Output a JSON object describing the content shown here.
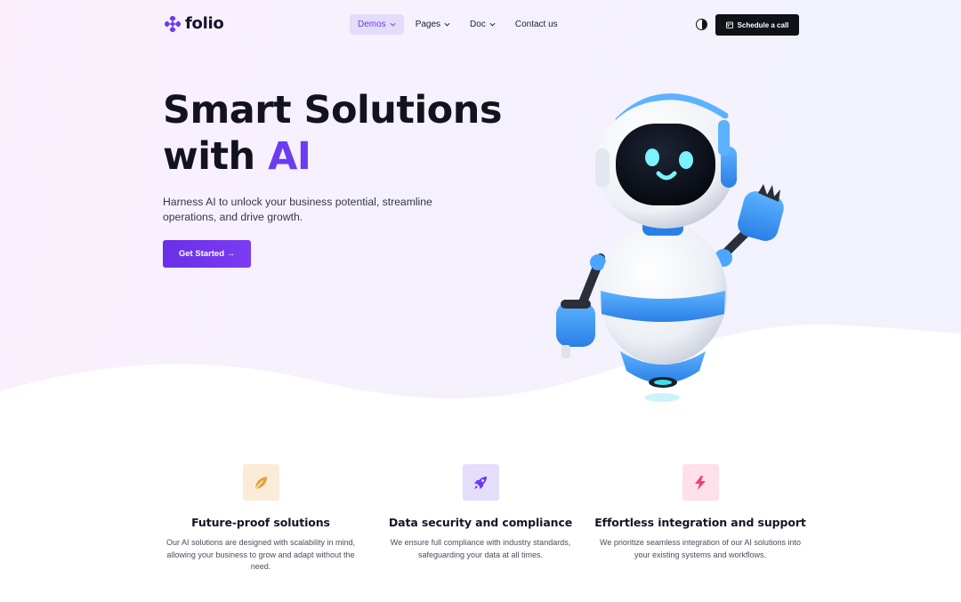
{
  "brand": {
    "name": "folio",
    "accent": "#6b3cf0"
  },
  "nav": {
    "items": [
      {
        "label": "Demos",
        "has_dropdown": true,
        "active": true
      },
      {
        "label": "Pages",
        "has_dropdown": true,
        "active": false
      },
      {
        "label": "Doc",
        "has_dropdown": true,
        "active": false
      },
      {
        "label": "Contact us",
        "has_dropdown": false,
        "active": false
      }
    ],
    "theme_toggle_icon": "half-circle-icon",
    "schedule_label": "Schedule a call",
    "schedule_icon": "calendar-icon"
  },
  "hero": {
    "title_line1": "Smart Solutions",
    "title_line2_prefix": "with ",
    "title_line2_accent": "AI",
    "subtitle": "Harness AI to unlock your business potential, streamline operations, and drive growth.",
    "cta_label": "Get Started →",
    "illustration": "robot-waving"
  },
  "features": [
    {
      "icon": "leaf-icon",
      "icon_bg": "#fbecd7",
      "icon_color": "#e5a23c",
      "title": "Future-proof solutions",
      "description": "Our AI solutions are designed with scalability in mind, allowing your business to grow and adapt without the need."
    },
    {
      "icon": "rocket-icon",
      "icon_bg": "#e4ddfb",
      "icon_color": "#6b3cf0",
      "title": "Data security and compliance",
      "description": "We ensure full compliance with industry standards, safeguarding your data at all times."
    },
    {
      "icon": "lightning-icon",
      "icon_bg": "#fde0ea",
      "icon_color": "#ef3f78",
      "title": "Effortless integration and support",
      "description": "We prioritize seamless integration of our AI solutions into your existing systems and workflows."
    }
  ]
}
